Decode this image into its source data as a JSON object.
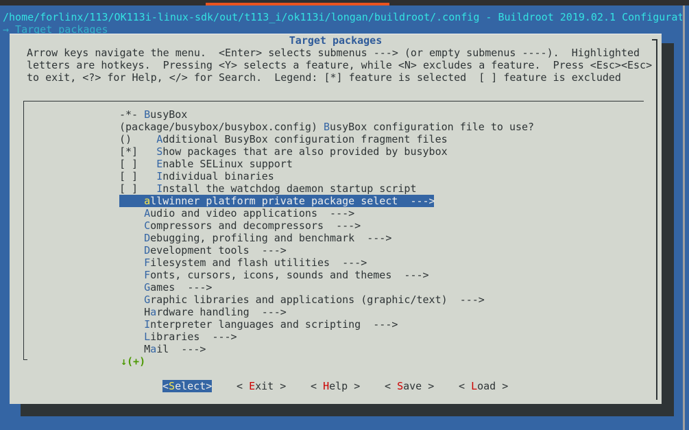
{
  "terminal": {
    "path_line": "/home/forlinx/113/OK113i-linux-sdk/out/t113_i/ok113i/longan/buildroot/.config - Buildroot 2019.02.1 Configurat",
    "breadcrumb": "→ Target packages"
  },
  "dialog": {
    "title": "Target packages",
    "help_lines": [
      "Arrow keys navigate the menu.  <Enter> selects submenus ---> (or empty submenus ----).  Highlighted",
      "letters are hotkeys.  Pressing <Y> selects a feature, while <N> excludes a feature.  Press <Esc><Esc>",
      "to exit, <?> for Help, </> for Search.  Legend: [*] feature is selected  [ ] feature is excluded"
    ]
  },
  "menu": {
    "items": [
      {
        "pre": "-*- ",
        "hk": "B",
        "post": "usyBox"
      },
      {
        "pre": "(package/busybox/busybox.config) ",
        "hk": "B",
        "post": "usyBox configuration file to use?"
      },
      {
        "pre": "()    ",
        "hk": "A",
        "post": "dditional BusyBox configuration fragment files"
      },
      {
        "pre": "[*]   ",
        "hk": "S",
        "post": "how packages that are also provided by busybox"
      },
      {
        "pre": "[ ]   ",
        "hk": "E",
        "post": "nable SELinux support"
      },
      {
        "pre": "[ ]   ",
        "hk": "I",
        "post": "ndividual binaries"
      },
      {
        "pre": "[ ]   ",
        "hk": "I",
        "post": "nstall the watchdog daemon startup script"
      },
      {
        "pre": "    ",
        "hk": "a",
        "post": "llwinner platform private package select  --->",
        "selected": true
      },
      {
        "pre": "    ",
        "hk": "A",
        "post": "udio and video applications  --->"
      },
      {
        "pre": "    ",
        "hk": "C",
        "post": "ompressors and decompressors  --->"
      },
      {
        "pre": "    ",
        "hk": "D",
        "post": "ebugging, profiling and benchmark  --->"
      },
      {
        "pre": "    ",
        "hk": "D",
        "post": "evelopment tools  --->"
      },
      {
        "pre": "    ",
        "hk": "F",
        "post": "ilesystem and flash utilities  --->"
      },
      {
        "pre": "    ",
        "hk": "F",
        "post": "onts, cursors, icons, sounds and themes  --->"
      },
      {
        "pre": "    ",
        "hk": "G",
        "post": "ames  --->"
      },
      {
        "pre": "    ",
        "hk": "G",
        "post": "raphic libraries and applications (graphic/text)  --->"
      },
      {
        "pre": "    H",
        "hk": "a",
        "post": "rdware handling  --->"
      },
      {
        "pre": "    ",
        "hk": "I",
        "post": "nterpreter languages and scripting  --->"
      },
      {
        "pre": "    ",
        "hk": "L",
        "post": "ibraries  --->"
      },
      {
        "pre": "    M",
        "hk": "a",
        "post": "il  --->"
      }
    ],
    "more_indicator": "↓(+)"
  },
  "buttons": [
    {
      "name": "select-button",
      "pre": "<",
      "hk": "S",
      "post": "elect>",
      "selected": true
    },
    {
      "name": "exit-button",
      "pre": "< ",
      "hk": "E",
      "post": "xit >"
    },
    {
      "name": "help-button",
      "pre": "< ",
      "hk": "H",
      "post": "elp >"
    },
    {
      "name": "save-button",
      "pre": "< ",
      "hk": "S",
      "post": "ave >"
    },
    {
      "name": "load-button",
      "pre": "< ",
      "hk": "L",
      "post": "oad >"
    }
  ],
  "colors": {
    "terminal_bg": "#3465a4",
    "dialog_bg": "#d3d7cf",
    "hotkey": "#3465a4",
    "highlight_bg": "#3465a4",
    "button_hotkey": "#cc0000"
  }
}
